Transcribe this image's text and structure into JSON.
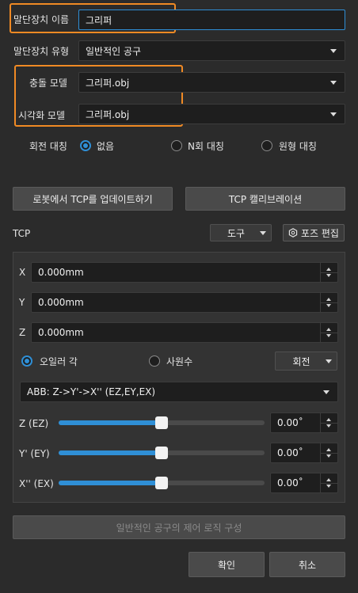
{
  "terminal_name": {
    "label": "말단장치 이름",
    "value": "그리퍼"
  },
  "terminal_type": {
    "label": "말단장치 유형",
    "value": "일반적인 공구"
  },
  "collision_model": {
    "label": "충돌 모델",
    "value": "그리퍼.obj"
  },
  "visual_model": {
    "label": "시각화 모델",
    "value": "그리퍼.obj"
  },
  "rotation_symmetry": {
    "label": "회전 대칭",
    "options": [
      "없음",
      "N회 대칭",
      "원형 대칭"
    ],
    "selected": "없음"
  },
  "buttons": {
    "update_tcp": "로봇에서 TCP를 업데이트하기",
    "tcp_calibration": "TCP 캘리브레이션",
    "pose_edit": "포즈 편집",
    "control_logic": "일반적인 공구의 제어 로직 구성",
    "confirm": "확인",
    "cancel": "취소"
  },
  "tcp": {
    "label": "TCP",
    "frame_select": "도구",
    "x": {
      "label": "X",
      "value": "0.000mm"
    },
    "y": {
      "label": "Y",
      "value": "0.000mm"
    },
    "z": {
      "label": "Z",
      "value": "0.000mm"
    },
    "orientation_mode": {
      "options": [
        "오일러 각",
        "사원수"
      ],
      "selected": "오일러 각"
    },
    "rotation_select": "회전",
    "euler_convention": "ABB: Z->Y'->X'' (EZ,EY,EX)",
    "angles": [
      {
        "label": "Z (EZ)",
        "value": "0.00˚",
        "level": 0.5
      },
      {
        "label": "Y' (EY)",
        "value": "0.00˚",
        "level": 0.5
      },
      {
        "label": "X'' (EX)",
        "value": "0.00˚",
        "level": 0.5
      }
    ]
  },
  "colors": {
    "accent": "#2f8fd6",
    "highlight": "#f08a24",
    "background": "#2b2b2b"
  }
}
